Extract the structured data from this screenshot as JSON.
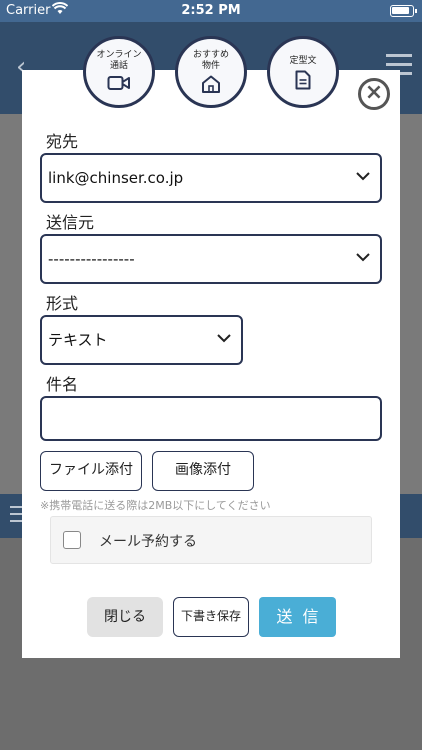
{
  "status_bar": {
    "carrier": "Carrier",
    "time": "2:52 PM"
  },
  "quick_actions": [
    {
      "label_line1": "オンライン",
      "label_line2": "通話",
      "icon": "video-camera-icon"
    },
    {
      "label_line1": "おすすめ",
      "label_line2": "物件",
      "icon": "house-icon"
    },
    {
      "label_line1": "定型文",
      "label_line2": "",
      "icon": "document-icon"
    }
  ],
  "form": {
    "to_label": "宛先",
    "to_value": "link@chinser.co.jp",
    "from_label": "送信元",
    "from_value": "----------------",
    "format_label": "形式",
    "format_value": "テキスト",
    "subject_label": "件名",
    "subject_value": "",
    "attach_file_label": "ファイル添付",
    "attach_image_label": "画像添付",
    "note": "※携帯電話に送る際は2MB以下にしてください",
    "schedule_label": "メール予約する"
  },
  "actions": {
    "close_label": "閉じる",
    "draft_label": "下書き保存",
    "send_label": "送信"
  },
  "colors": {
    "header": "#436891",
    "border": "#2a3554",
    "send": "#4aaed6"
  }
}
